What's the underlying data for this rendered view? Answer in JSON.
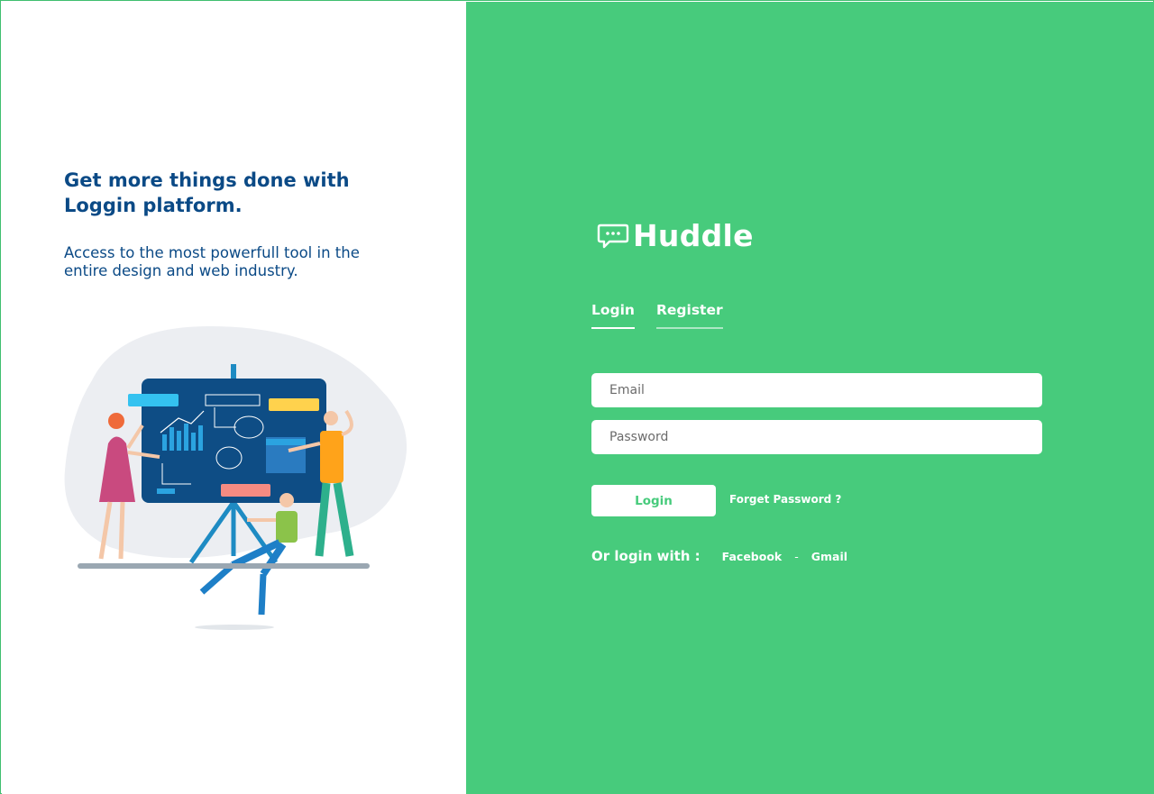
{
  "hero": {
    "headline": "Get more things done with Loggin platform.",
    "subtitle": "Access to the most powerfull tool in the entire design and web industry."
  },
  "brand": {
    "name": "Huddle",
    "icon": "chat-bubble-icon"
  },
  "tabs": [
    {
      "label": "Login",
      "active": true
    },
    {
      "label": "Register",
      "active": false
    }
  ],
  "form": {
    "email_placeholder": "Email",
    "password_placeholder": "Password",
    "login_label": "Login",
    "forgot_label": "Forget Password ?"
  },
  "social": {
    "label": "Or login with :",
    "facebook": "Facebook",
    "separator": "-",
    "gmail": "Gmail"
  },
  "colors": {
    "accent": "#47cb7c",
    "heading": "#0b4a86",
    "white": "#ffffff"
  }
}
